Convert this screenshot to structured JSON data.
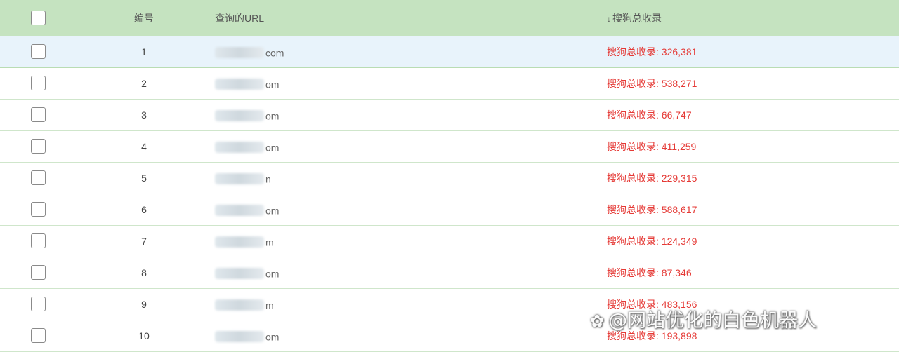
{
  "header": {
    "number_label": "编号",
    "url_label": "查询的URL",
    "sort_glyph": "↓",
    "count_label": "搜狗总收录"
  },
  "rows": [
    {
      "number": "1",
      "url_suffix": "com",
      "count": "搜狗总收录: 326,381",
      "selected": true
    },
    {
      "number": "2",
      "url_suffix": "om",
      "count": "搜狗总收录: 538,271",
      "selected": false
    },
    {
      "number": "3",
      "url_suffix": "om",
      "count": "搜狗总收录: 66,747",
      "selected": false
    },
    {
      "number": "4",
      "url_suffix": "om",
      "count": "搜狗总收录: 411,259",
      "selected": false
    },
    {
      "number": "5",
      "url_suffix": "n",
      "count": "搜狗总收录: 229,315",
      "selected": false
    },
    {
      "number": "6",
      "url_suffix": "om",
      "count": "搜狗总收录: 588,617",
      "selected": false
    },
    {
      "number": "7",
      "url_suffix": "m",
      "count": "搜狗总收录: 124,349",
      "selected": false
    },
    {
      "number": "8",
      "url_suffix": "om",
      "count": "搜狗总收录: 87,346",
      "selected": false
    },
    {
      "number": "9",
      "url_suffix": "m",
      "count": "搜狗总收录: 483,156",
      "selected": false
    },
    {
      "number": "10",
      "url_suffix": "om",
      "count": "搜狗总收录: 193,898",
      "selected": false
    }
  ],
  "watermark": {
    "icon": "头条-icon",
    "text": "@网站优化的白色机器人"
  },
  "colors": {
    "header_bg": "#c5e3c0",
    "selected_row_bg": "#e8f3fb",
    "count_text": "#e53935"
  }
}
